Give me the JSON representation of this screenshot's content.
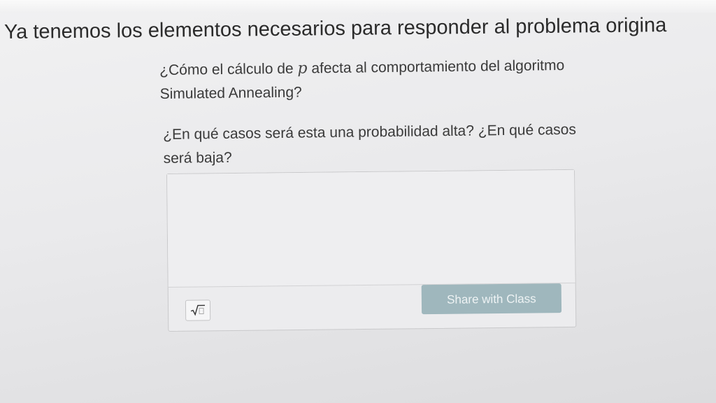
{
  "heading": "Ya tenemos los elementos necesarios para responder al problema origina",
  "question1": {
    "before": "¿Cómo el cálculo de",
    "variable": "p",
    "after": "afecta al comportamiento del algoritmo Simulated Annealing?"
  },
  "question2": "¿En qué casos será esta una probabilidad alta? ¿En qué casos será baja?",
  "answer": {
    "value": "",
    "placeholder": ""
  },
  "toolbar": {
    "math_icon": "square-root-icon",
    "share_label": "Share with Class"
  },
  "colors": {
    "share_button": "#9fb7bd",
    "share_text": "#eef3f4",
    "background": "#ebebed"
  }
}
